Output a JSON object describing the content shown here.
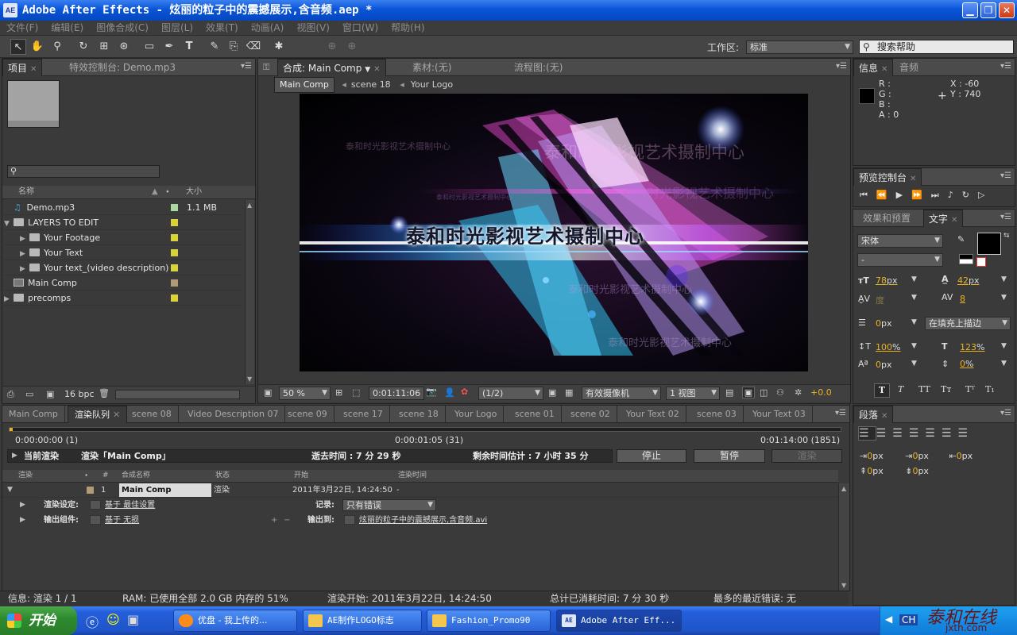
{
  "window": {
    "app_logo": "AE",
    "title": "Adobe After Effects - 炫丽的粒子中的震撼展示,含音频.aep *"
  },
  "menu": [
    "文件(F)",
    "编辑(E)",
    "图像合成(C)",
    "图层(L)",
    "效果(T)",
    "动画(A)",
    "视图(V)",
    "窗口(W)",
    "帮助(H)"
  ],
  "toolbar": {
    "workspace_label": "工作区:",
    "workspace_value": "标准",
    "search_placeholder": "搜索帮助"
  },
  "project": {
    "tabs": [
      "项目",
      "特效控制台: Demo.mp3"
    ],
    "columns": {
      "name": "名称",
      "size": "大小"
    },
    "items": [
      {
        "name": "Demo.mp3",
        "size": "1.1 MB",
        "color": "#a9d9a0"
      },
      {
        "name": "LAYERS TO EDIT",
        "size": "",
        "color": "#d9d23a"
      },
      {
        "name": "Your Footage",
        "size": "",
        "color": "#d9d23a"
      },
      {
        "name": "Your Text",
        "size": "",
        "color": "#d9d23a"
      },
      {
        "name": "Your text_(video description)",
        "size": "",
        "color": "#d9d23a"
      },
      {
        "name": "Main Comp",
        "size": "",
        "color": "#b19a74"
      },
      {
        "name": "precomps",
        "size": "",
        "color": "#d9d23a"
      }
    ],
    "bpc": "16 bpc"
  },
  "comp": {
    "tabs": [
      "合成: Main Comp",
      "素材:(无)",
      "流程图:(无)"
    ],
    "breadcrumbs": [
      "Main Comp",
      "scene 18",
      "Your Logo"
    ],
    "viewer_texts": {
      "main": "泰和时光影视艺术摄制中心",
      "ghost1": "泰和时光影视艺术摄制中心",
      "ghost2": "泰和时光影视艺术摄制中心",
      "ghost3": "泰和时光影视艺术摄制中心",
      "ghost4": "泰和时光影视艺术摄制中心",
      "ghost5": "泰和时光影视艺术摄制中心",
      "ghost6": "泰和时光影视艺术摄制中心"
    },
    "zoom": "50 %",
    "timecode": "0:01:11:06",
    "resolution": "(1/2)",
    "camera": "有效摄像机",
    "views": "1 视图",
    "exposure": "+0.0"
  },
  "info": {
    "tabs": [
      "信息",
      "音频"
    ],
    "r": "R :",
    "g": "G :",
    "b": "B :",
    "a": "A : 0",
    "x": "X : -60",
    "y": "Y : 740"
  },
  "preview": {
    "tab": "预览控制台"
  },
  "character": {
    "tabs": [
      "效果和预置",
      "文字"
    ],
    "font": "宋体",
    "style": "-",
    "size": "78",
    "size_unit": "px",
    "leading": "42",
    "leading_unit": "px",
    "kerning": "度",
    "tracking": "8",
    "stroke": "0",
    "stroke_unit": "px",
    "stroke_mode": "在填充上描边",
    "vscale": "100",
    "hscale": "123",
    "pct": "%",
    "baseline": "0",
    "baseline_unit": "px",
    "tsume": "0",
    "tsume_unit": "%"
  },
  "paragraph": {
    "tab": "段落",
    "v1": "0",
    "v2": "0",
    "v3": "0",
    "v4": "0",
    "v5": "0",
    "unit": "px"
  },
  "render": {
    "tabs": [
      "Main Comp",
      "渲染队列",
      "scene 08",
      "Video Description 07",
      "scene 09",
      "scene 17",
      "scene 18",
      "Your Logo",
      "scene 01",
      "scene 02",
      "Your Text 02",
      "scene 03",
      "Your Text 03"
    ],
    "progress": 0.004,
    "time_start": "0:00:00:00 (1)",
    "time_mid": "0:00:01:05 (31)",
    "time_end": "0:01:14:00 (1851)",
    "current_label": "当前渲染",
    "rendering_label": "渲染「Main Comp」",
    "elapsed": "逝去时间 : 7 分 29 秒",
    "remaining": "剩余时间估计 : 7 小时 35 分",
    "stop": "停止",
    "pause": "暂停",
    "render": "渲染",
    "cols": [
      "渲染",
      "#",
      "合成名称",
      "状态",
      "开始",
      "渲染时间"
    ],
    "item": {
      "num": "1",
      "name": "Main Comp",
      "status": "渲染",
      "start": "2011年3月22日, 14:24:50",
      "time": "-"
    },
    "settings_label": "渲染设定:",
    "settings_value": "基于 最佳设置",
    "log_label": "记录:",
    "log_value": "只有错误",
    "output_label": "输出组件:",
    "output_value": "基于 无损",
    "output_to_label": "输出到:",
    "output_to_value": "炫丽的粒子中的震撼展示,含音频.avi"
  },
  "status": {
    "info": "信息: 渲染 1 / 1",
    "ram": "RAM: 已使用全部 2.0 GB 内存的 51%",
    "start": "渲染开始: 2011年3月22日, 14:24:50",
    "total": "总计已消耗时间: 7 分 30 秒",
    "error": "最多的最近错误: 无"
  },
  "taskbar": {
    "start": "开始",
    "tasks": [
      "优盘 - 我上传的...",
      "AE制作LOGO标志",
      "Fashion_Promo90",
      "Adobe After Eff..."
    ],
    "lang": "CH",
    "watermark": "泰和在线",
    "watermark_url": "jxth.com"
  }
}
